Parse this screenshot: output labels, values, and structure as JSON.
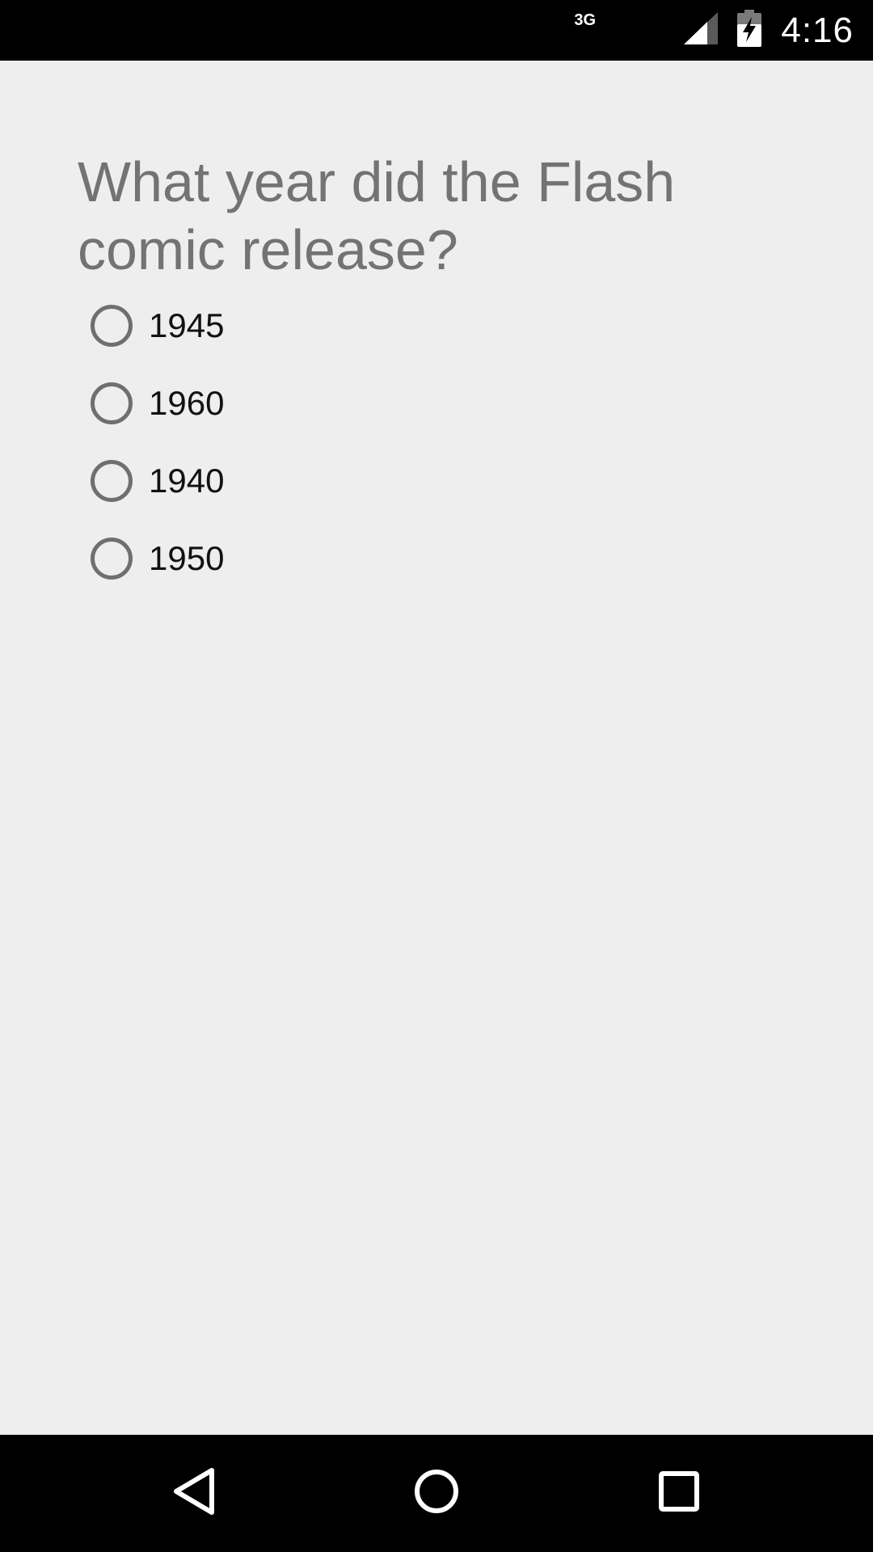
{
  "status_bar": {
    "network_type": "3G",
    "time": "4:16",
    "icons": [
      "signal-icon",
      "battery-charging-icon"
    ]
  },
  "quiz": {
    "question": "What year did the Flash comic release?",
    "options": [
      {
        "label": "1945",
        "selected": false
      },
      {
        "label": "1960",
        "selected": false
      },
      {
        "label": "1940",
        "selected": false
      },
      {
        "label": "1950",
        "selected": false
      }
    ]
  },
  "nav_bar": {
    "icons": [
      "back-icon",
      "home-icon",
      "recents-icon"
    ]
  },
  "colors": {
    "background": "#eeeeee",
    "question_text": "#737373",
    "radio_border": "#6f6f6f",
    "bars": "#000000"
  }
}
